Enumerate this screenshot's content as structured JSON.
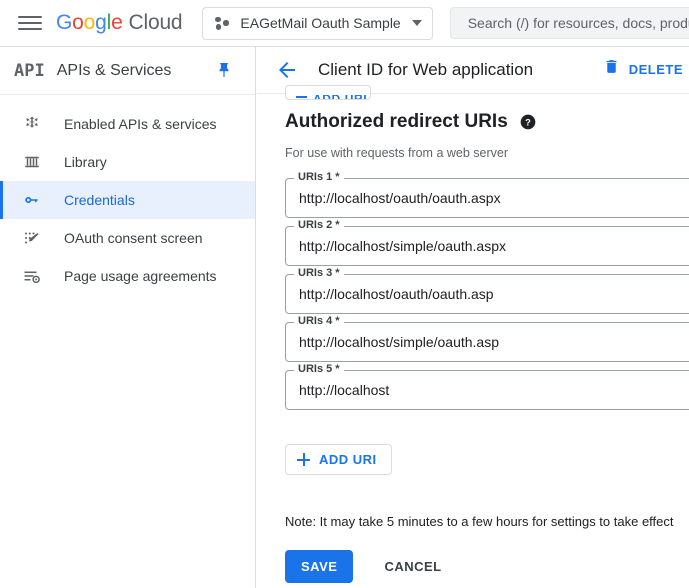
{
  "topbar": {
    "menu_icon": "hamburger-menu-icon",
    "brand_google": "Google",
    "brand_cloud": "Cloud",
    "project": {
      "icon": "project-dots-icon",
      "name": "EAGetMail Oauth Sample",
      "caret_icon": "chevron-down-icon"
    },
    "search": {
      "icon": "search-icon",
      "value": "",
      "placeholder": "Search (/) for resources, docs, products, and more"
    }
  },
  "sidebar": {
    "logo_text": "API",
    "title": "APIs & Services",
    "pin_icon": "pin-icon",
    "items": [
      {
        "label": "Enabled APIs & services",
        "icon": "enabled-apis-icon",
        "active": false
      },
      {
        "label": "Library",
        "icon": "library-icon",
        "active": false
      },
      {
        "label": "Credentials",
        "icon": "key-icon",
        "active": true
      },
      {
        "label": "OAuth consent screen",
        "icon": "oauth-consent-icon",
        "active": false
      },
      {
        "label": "Page usage agreements",
        "icon": "page-usage-agreements-icon",
        "active": false
      }
    ]
  },
  "main": {
    "back_icon": "back-arrow-icon",
    "title": "Client ID for Web application",
    "delete": {
      "icon": "trash-icon",
      "label": "DELETE"
    },
    "section": {
      "title": "Authorized redirect URIs",
      "help_icon": "help-circle-icon",
      "subtitle": "For use with requests from a web server"
    },
    "uris": [
      {
        "label": "URIs 1 *",
        "value": "http://localhost/oauth/oauth.aspx"
      },
      {
        "label": "URIs 2 *",
        "value": "http://localhost/simple/oauth.aspx"
      },
      {
        "label": "URIs 3 *",
        "value": "http://localhost/oauth/oauth.asp"
      },
      {
        "label": "URIs 4 *",
        "value": "http://localhost/simple/oauth.asp"
      },
      {
        "label": "URIs 5 *",
        "value": "http://localhost"
      }
    ],
    "add_uri": {
      "icon": "plus-icon",
      "label": "ADD URI"
    },
    "note": "Note: It may take 5 minutes to a few hours for settings to take effect",
    "save_label": "SAVE",
    "cancel_label": "CANCEL"
  },
  "colors": {
    "accent_blue": "#1a73e8",
    "active_nav_bg": "#e8f0fe",
    "active_nav_text": "#1967d2",
    "border": "#dadce0",
    "text_primary": "#202124",
    "text_secondary": "#5f6368"
  }
}
